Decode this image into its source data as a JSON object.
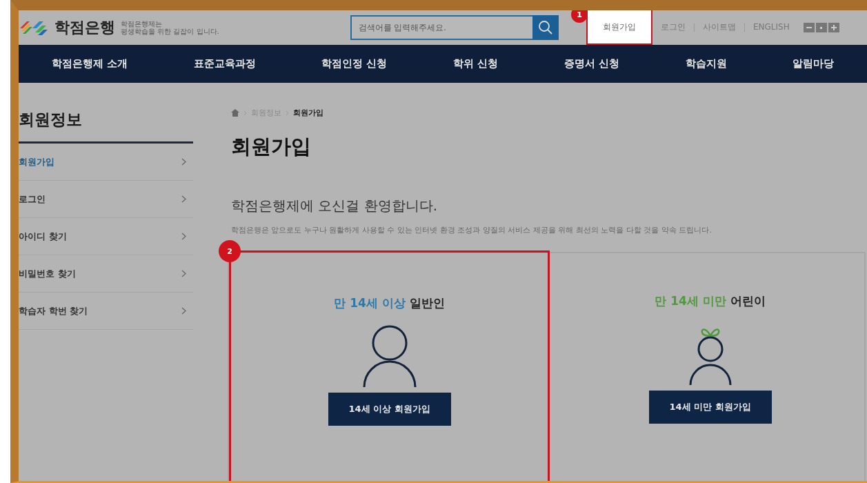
{
  "header": {
    "logo_title": "학점은행",
    "tagline": [
      "학점은행제는",
      "평생학습을 위한 길잡이 입니다."
    ],
    "search": {
      "placeholder": "검색어를 입력해주세요."
    },
    "util_links": [
      {
        "label": "회원가입",
        "highlighted": true,
        "annotation": "1"
      },
      {
        "label": "로그인",
        "highlighted": false
      },
      {
        "label": "사이트맵",
        "highlighted": false
      },
      {
        "label": "ENGLISH",
        "highlighted": false
      }
    ]
  },
  "nav": [
    "학점은행제 소개",
    "표준교육과정",
    "학점인정 신청",
    "학위 신청",
    "증명서 신청",
    "학습지원",
    "알림마당"
  ],
  "sidebar": {
    "title": "회원정보",
    "items": [
      {
        "label": "회원가입",
        "selected": true
      },
      {
        "label": "로그인",
        "selected": false
      },
      {
        "label": "아이디 찾기",
        "selected": false
      },
      {
        "label": "비밀번호 찾기",
        "selected": false
      },
      {
        "label": "학습자 학번 찾기",
        "selected": false
      }
    ]
  },
  "breadcrumb": [
    "회원정보",
    "회원가입"
  ],
  "page_title": "회원가입",
  "welcome": "학점은행제에 오신걸 환영합니다.",
  "description": "학점은행은 앞으로도 누구나 원활하게 사용할 수 있는 인터넷 환경 조성과 양질의 서비스 제공을 위해 최선의 노력을 다할 것을 약속 드립니다.",
  "cards": [
    {
      "kind": "adult",
      "accent": "만 14세 이상",
      "rest": "일반인",
      "color": "#2d78a8",
      "button": "14세 이상 회원가입",
      "annotation": "2"
    },
    {
      "kind": "child",
      "accent": "만 14세 미만",
      "rest": "어린이",
      "color": "#4f9a3a",
      "button": "14세 미만 회원가입"
    }
  ]
}
